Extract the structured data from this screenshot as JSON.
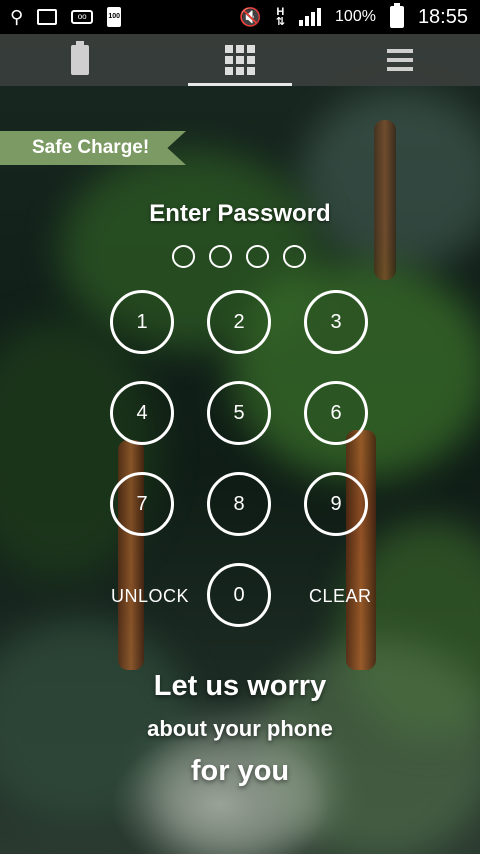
{
  "status_bar": {
    "left_icons": [
      "usb-icon",
      "image-icon",
      "voicemail-icon",
      "battery-100-icon"
    ],
    "battery_small_label": "100",
    "network_type": "H",
    "battery_percent": "100%",
    "time": "18:55"
  },
  "top_nav": {
    "tabs": [
      {
        "icon": "battery-icon",
        "active": false
      },
      {
        "icon": "keypad-grid-icon",
        "active": true
      },
      {
        "icon": "menu-icon",
        "active": false
      }
    ]
  },
  "ribbon": {
    "label": "Safe Charge!",
    "color": "#7c9a63"
  },
  "pin": {
    "title": "Enter Password",
    "dot_count": 4,
    "keys": [
      "1",
      "2",
      "3",
      "4",
      "5",
      "6",
      "7",
      "8",
      "9",
      "0"
    ],
    "unlock_label": "UNLOCK",
    "clear_label": "CLEAR"
  },
  "slogan": {
    "line1": "Let us worry",
    "line2": "about your phone",
    "line3": "for you"
  }
}
